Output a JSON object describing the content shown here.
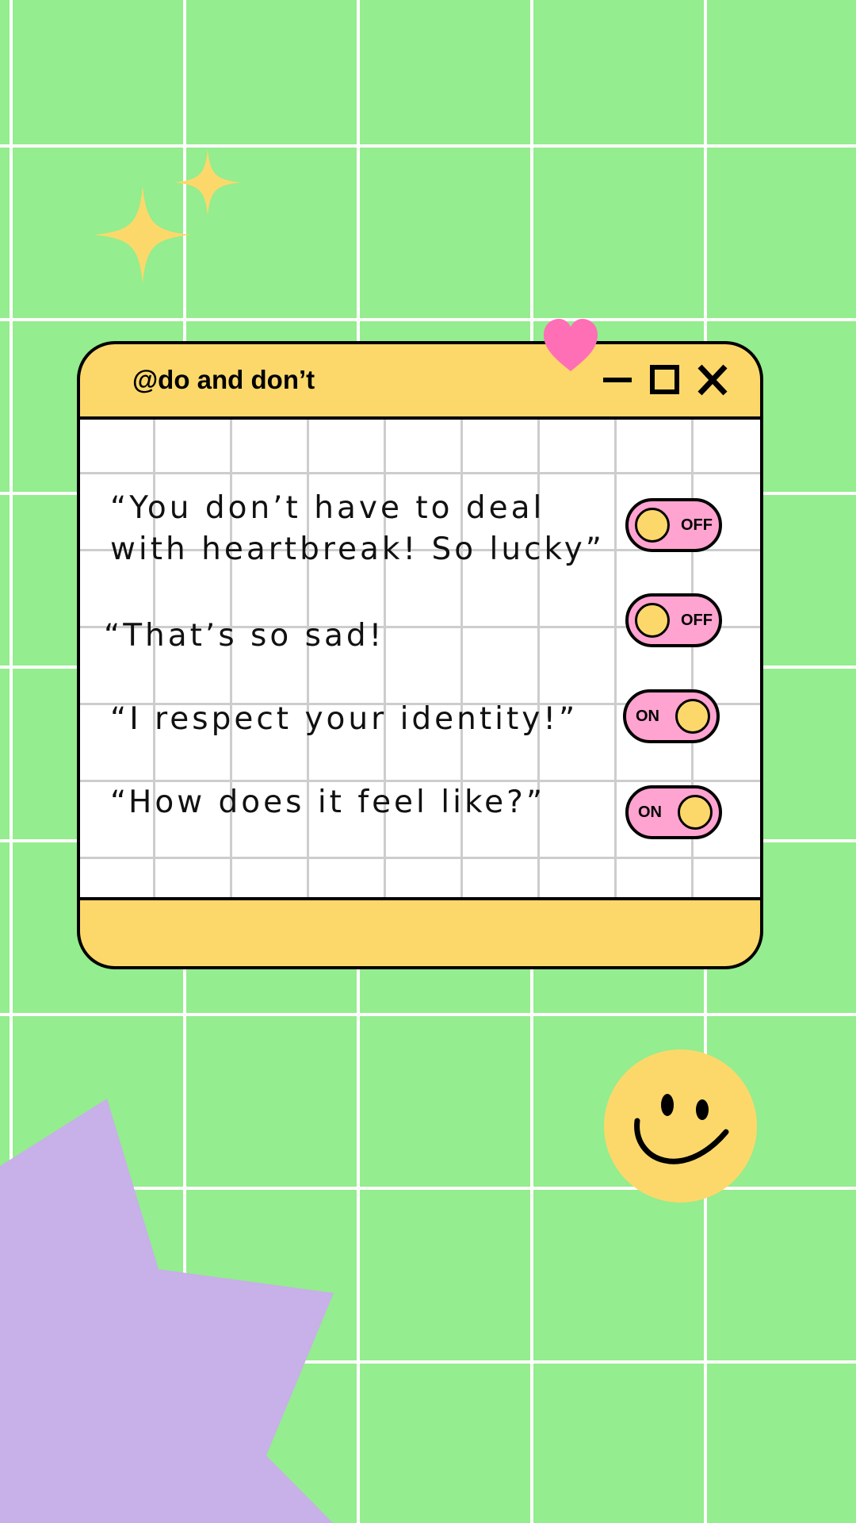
{
  "window": {
    "title": "@do and don’t",
    "controls": [
      "minimize",
      "maximize",
      "close"
    ]
  },
  "rows": [
    {
      "text_line1": "“You don’t have to deal",
      "text_line2": "with heartbreak! So lucky”",
      "toggle": "OFF"
    },
    {
      "text": "“That’s so sad!",
      "toggle": "OFF"
    },
    {
      "text": "“I respect your identity!”",
      "toggle": "ON"
    },
    {
      "text": "“How does it feel like?”",
      "toggle": "ON"
    }
  ],
  "colors": {
    "background": "#94ED8E",
    "window_yellow": "#FCD86B",
    "toggle_pink": "#FFA3D0",
    "heart_pink": "#FF6FB5",
    "blob_purple": "#C8B0E8",
    "sparkle_yellow": "#FCD86B"
  },
  "icons": [
    "sparkle-icon",
    "heart-icon",
    "smiley-icon",
    "minimize-icon",
    "maximize-icon",
    "close-icon"
  ]
}
